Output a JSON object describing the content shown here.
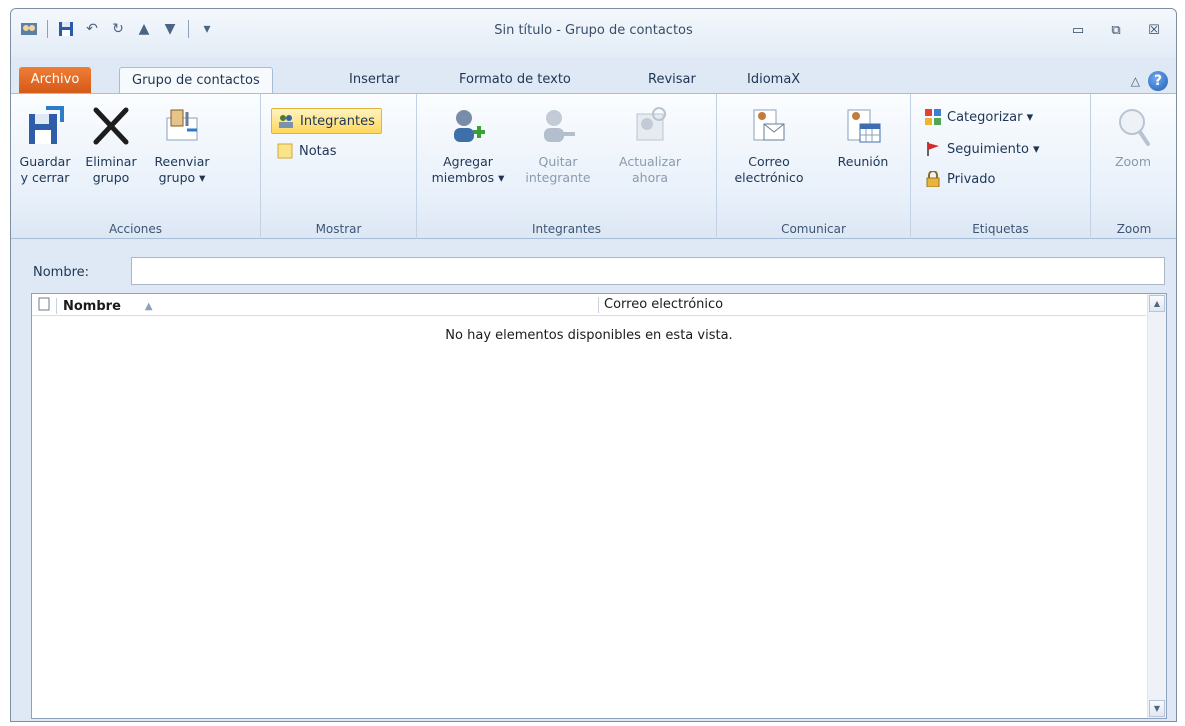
{
  "window": {
    "title": "Sin título  -  Grupo de contactos",
    "controls": {
      "minimize": "▭",
      "restore": "⧉",
      "close": "☒"
    }
  },
  "qat": {
    "icons": [
      "contact-group-app-icon",
      "save-icon",
      "undo-icon",
      "redo-icon",
      "up-icon",
      "down-icon",
      "customize-qat-icon"
    ]
  },
  "tabs": [
    {
      "label": "Archivo"
    },
    {
      "label": "Grupo de contactos"
    },
    {
      "label": "Insertar"
    },
    {
      "label": "Formato de texto"
    },
    {
      "label": "Revisar"
    },
    {
      "label": "IdiomaX"
    }
  ],
  "ribbon": {
    "acciones": {
      "label": "Acciones",
      "guardar": {
        "line1": "Guardar",
        "line2": "y cerrar"
      },
      "eliminar": {
        "line1": "Eliminar",
        "line2": "grupo"
      },
      "reenviar": {
        "line1": "Reenviar",
        "line2": "grupo ▾"
      }
    },
    "mostrar": {
      "label": "Mostrar",
      "integrantes": "Integrantes",
      "notas": "Notas"
    },
    "integrantes": {
      "label": "Integrantes",
      "agregar": {
        "line1": "Agregar",
        "line2": "miembros ▾"
      },
      "quitar": {
        "line1": "Quitar",
        "line2": "integrante"
      },
      "actualizar": {
        "line1": "Actualizar",
        "line2": "ahora"
      }
    },
    "comunicar": {
      "label": "Comunicar",
      "correo": {
        "line1": "Correo",
        "line2": "electrónico"
      },
      "reunion": {
        "line1": "Reunión"
      }
    },
    "etiquetas": {
      "label": "Etiquetas",
      "categorizar": "Categorizar ▾",
      "seguimiento": "Seguimiento ▾",
      "privado": "Privado"
    },
    "zoom": {
      "label": "Zoom",
      "zoom": "Zoom"
    }
  },
  "form": {
    "name_label": "Nombre:",
    "name_value": ""
  },
  "list": {
    "columns": [
      "Nombre",
      "Correo electrónico"
    ],
    "empty_message": "No hay elementos disponibles en esta vista."
  }
}
